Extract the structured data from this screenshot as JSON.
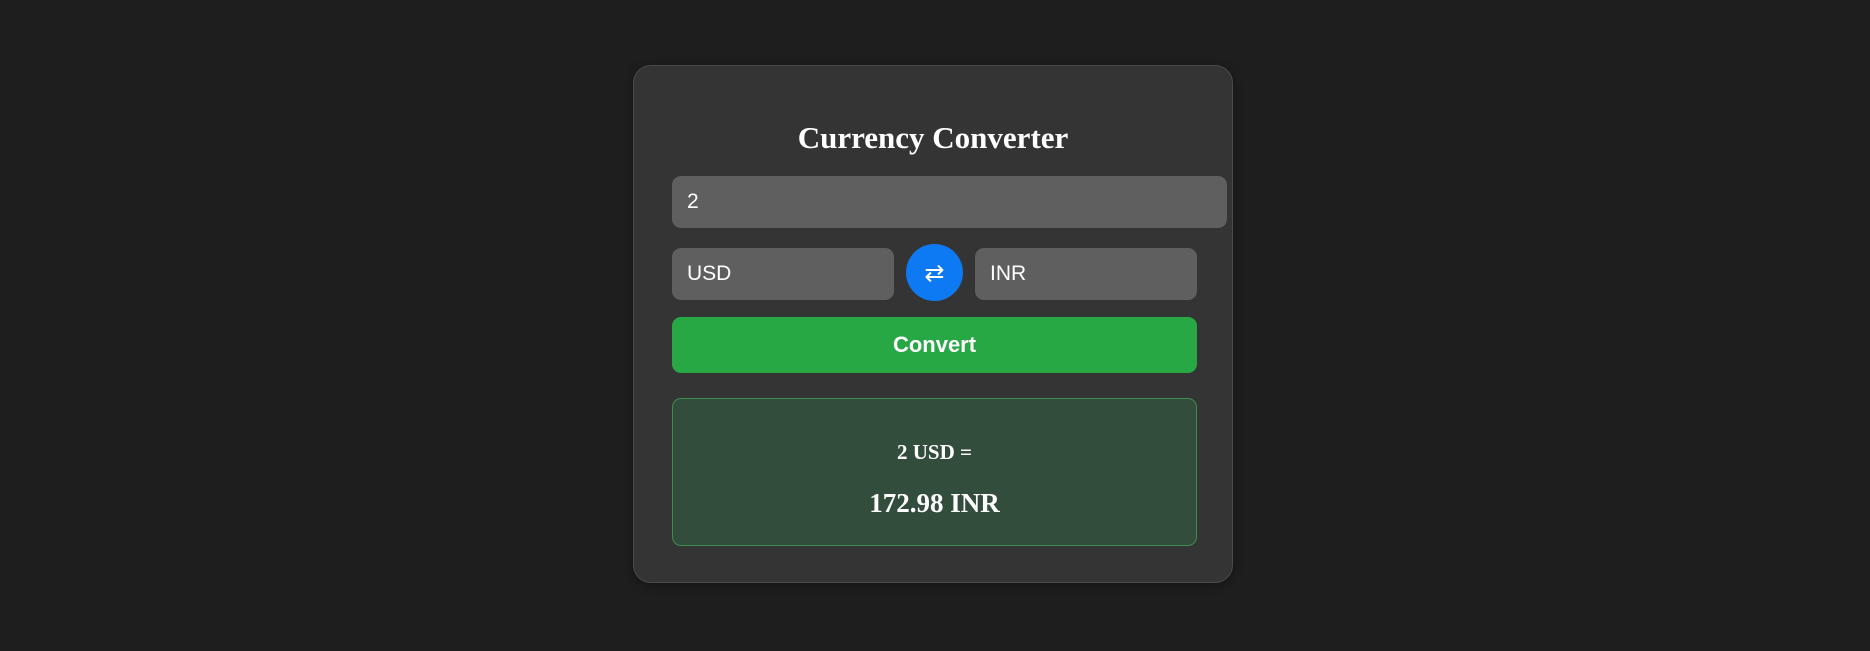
{
  "converter": {
    "title": "Currency Converter",
    "amount_value": "2",
    "from_currency": "USD",
    "to_currency": "INR",
    "swap_icon": "swap-arrows-icon",
    "swap_glyph": "⇄",
    "convert_label": "Convert"
  },
  "result": {
    "line1": "2 USD =",
    "line2": "172.98 INR"
  },
  "colors": {
    "background": "#1e1e1e",
    "card": "#343434",
    "input": "#5f5f5f",
    "swap_button": "#0d79f2",
    "convert_button": "#28a745",
    "result_panel": "#324d3b",
    "result_border": "#3f8a4d"
  }
}
